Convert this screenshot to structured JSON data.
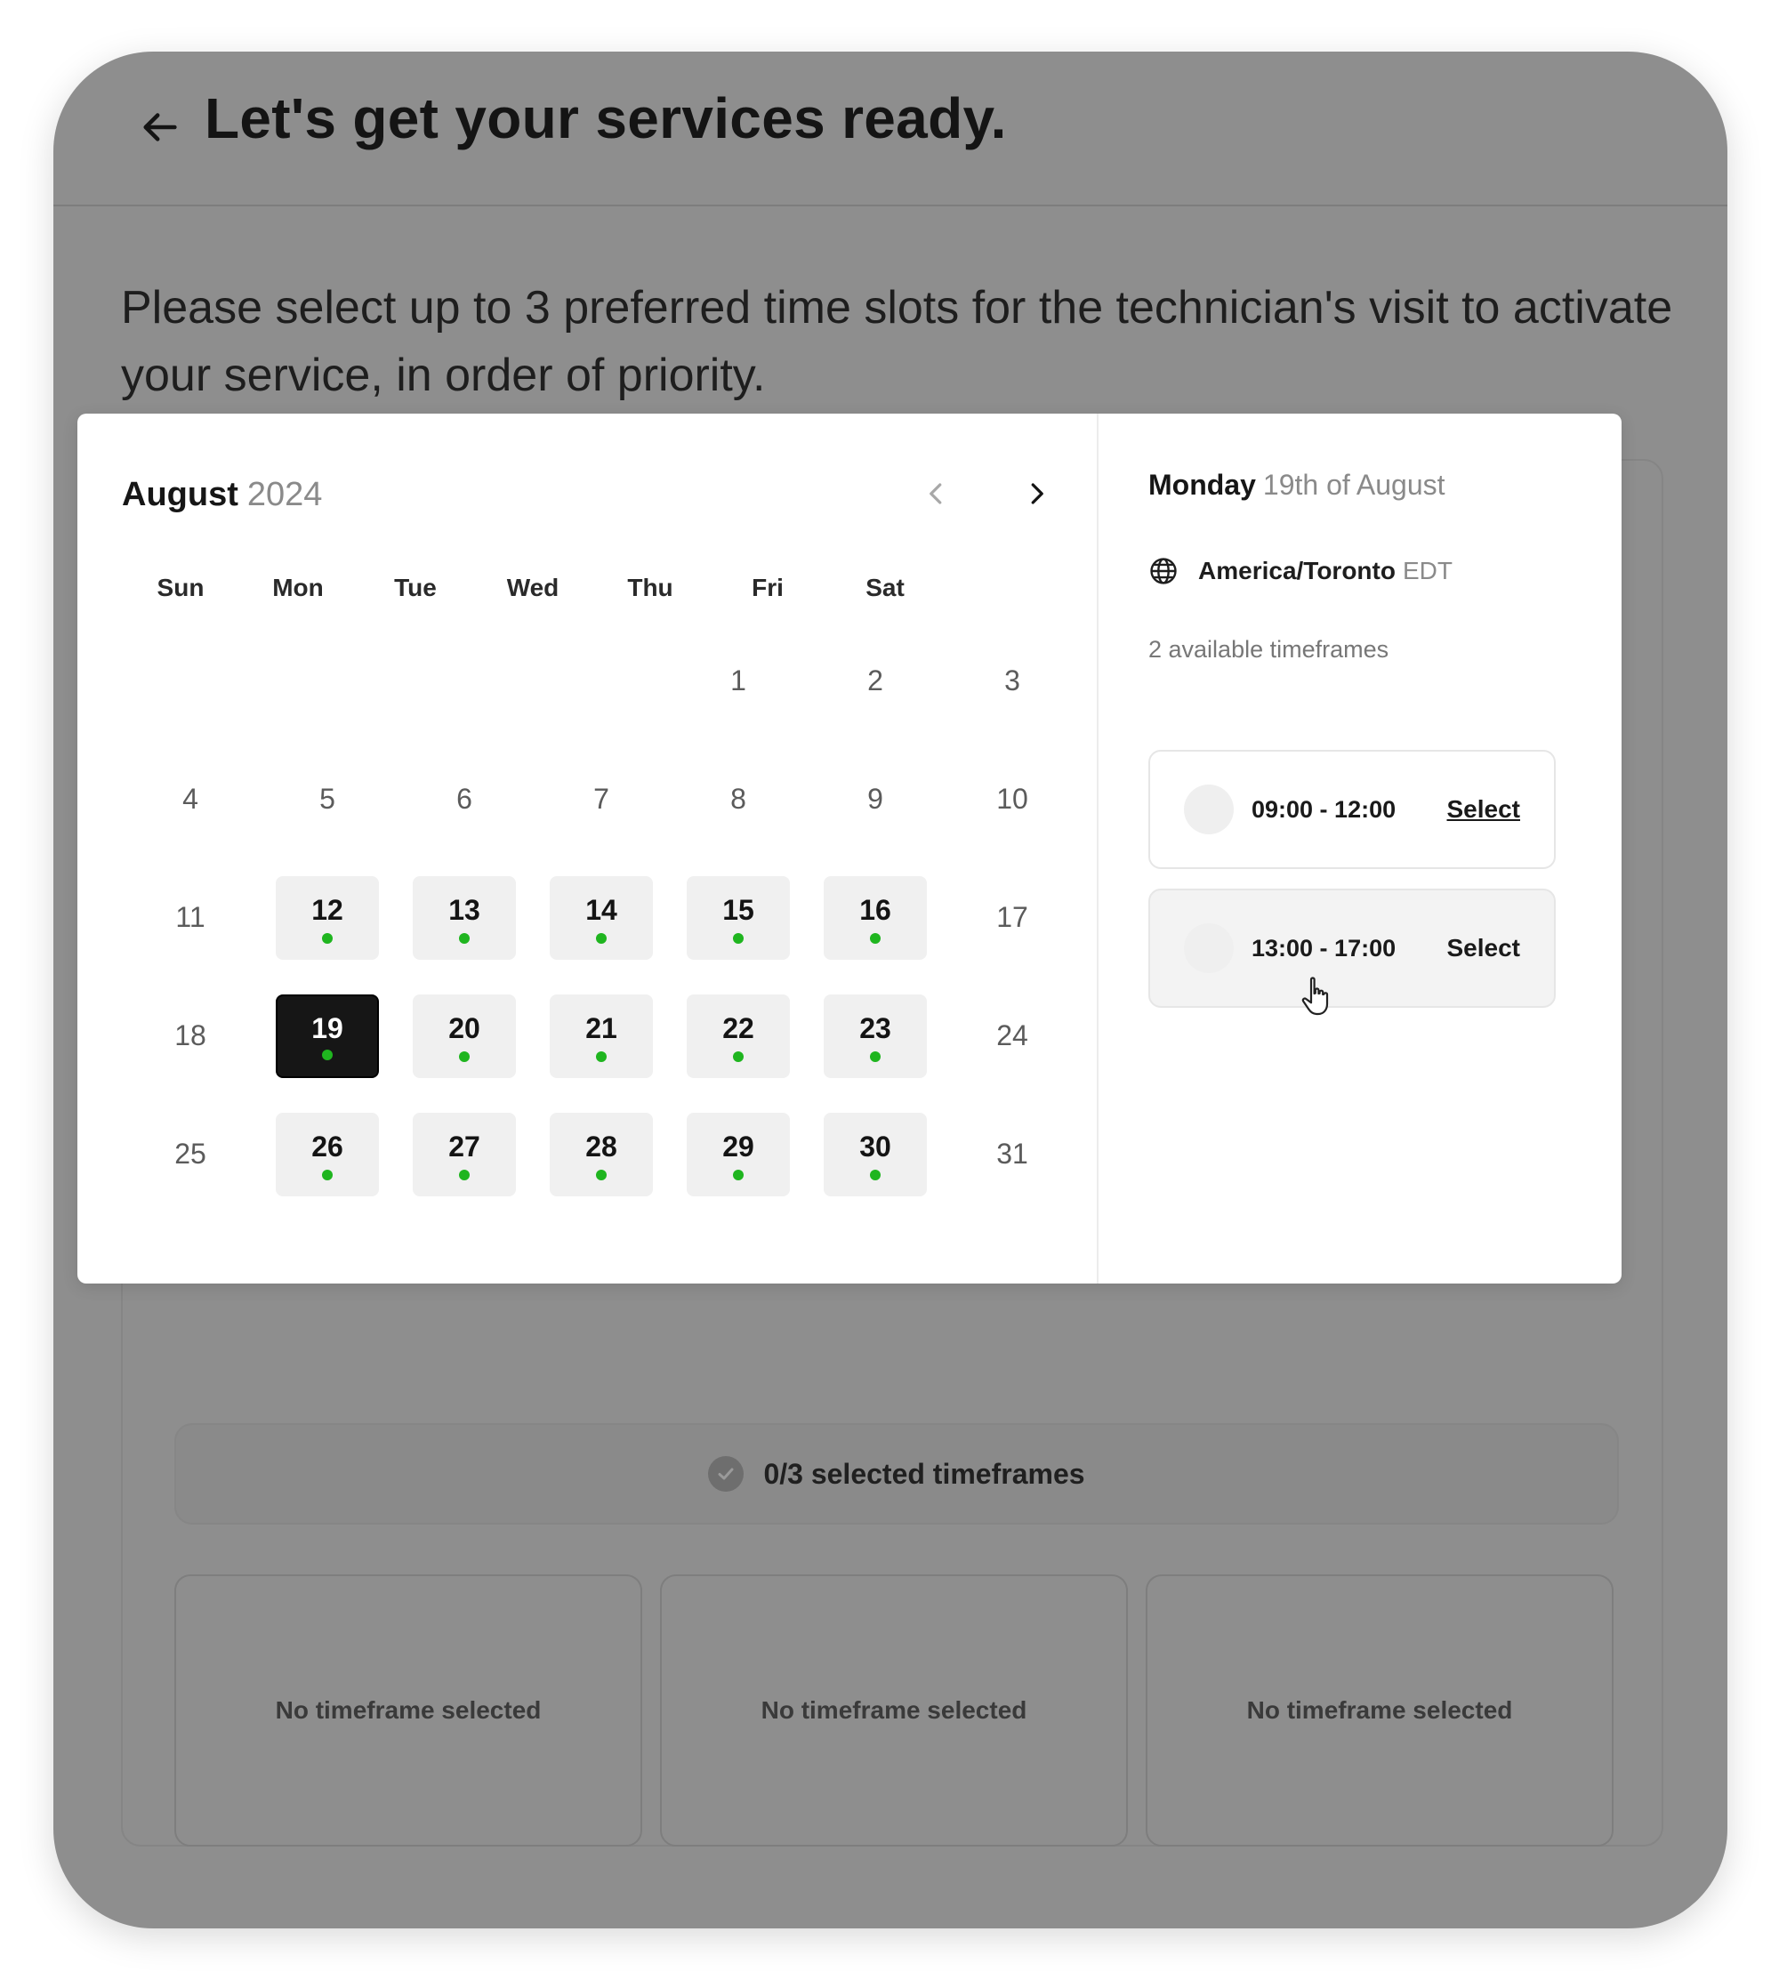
{
  "header": {
    "title": "Let's get your services ready."
  },
  "instructions": "Please select up to 3 preferred time slots for the technician's visit to activate your service, in order of priority.",
  "calendar": {
    "month": "August",
    "year": "2024",
    "weekdays": [
      "Sun",
      "Mon",
      "Tue",
      "Wed",
      "Thu",
      "Fri",
      "Sat"
    ],
    "first_weekday_index": 4,
    "days_in_month": 31,
    "available_days": [
      12,
      13,
      14,
      15,
      16,
      19,
      20,
      21,
      22,
      23,
      26,
      27,
      28,
      29,
      30
    ],
    "selected_day": 19
  },
  "day_panel": {
    "weekday": "Monday",
    "date_text": "19th of August",
    "timezone_name": "America/Toronto",
    "timezone_abbr": "EDT",
    "available_count_text": "2 available timeframes",
    "slots": [
      {
        "time": "09:00 - 12:00",
        "action": "Select"
      },
      {
        "time": "13:00 - 17:00",
        "action": "Select"
      }
    ]
  },
  "summary": {
    "selected_text": "0/3 selected timeframes",
    "slots": [
      "No timeframe selected",
      "No timeframe selected",
      "No timeframe selected"
    ]
  },
  "colors": {
    "overlay": "#8e8e8e",
    "available_dot": "#1fb51f",
    "selected_day_bg": "#161616"
  }
}
